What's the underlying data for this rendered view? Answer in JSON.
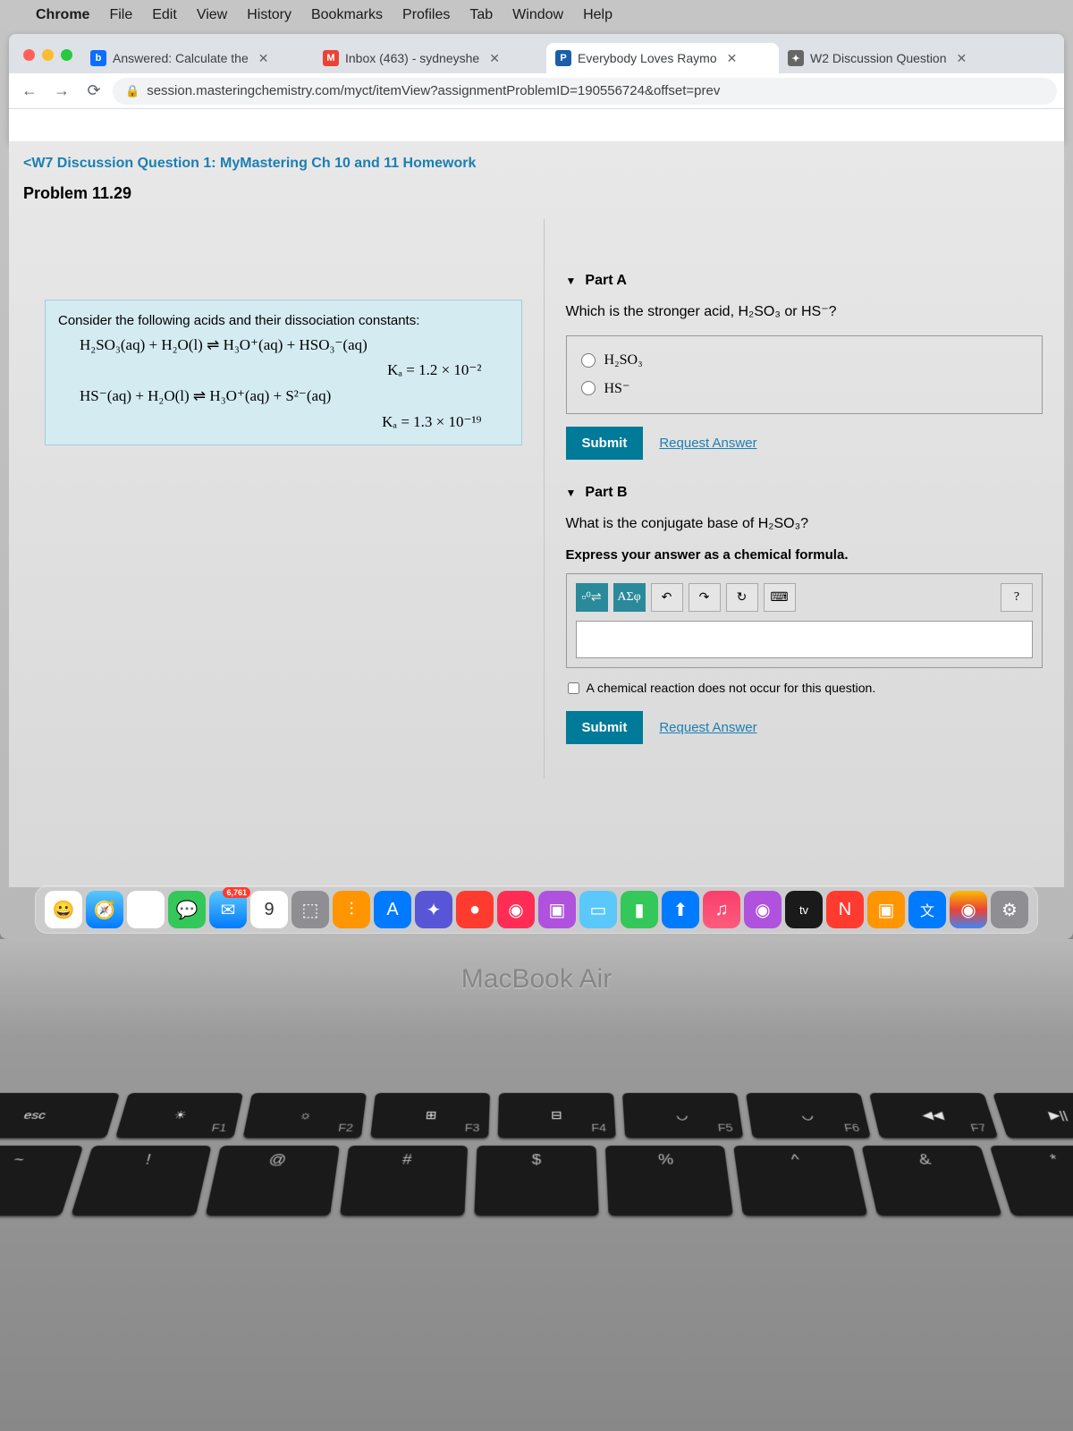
{
  "menubar": {
    "app": "Chrome",
    "items": [
      "File",
      "Edit",
      "View",
      "History",
      "Bookmarks",
      "Profiles",
      "Tab",
      "Window",
      "Help"
    ]
  },
  "tabs": [
    {
      "favicon": "b",
      "favcolor": "#0d6efd",
      "title": "Answered: Calculate the"
    },
    {
      "favicon": "M",
      "favcolor": "#ea4335",
      "title": "Inbox (463) - sydneyshe"
    },
    {
      "favicon": "P",
      "favcolor": "#1b5faa",
      "title": "Everybody Loves Raymo"
    },
    {
      "favicon": "✦",
      "favcolor": "#666",
      "title": "W2 Discussion Question"
    }
  ],
  "url": "session.masteringchemistry.com/myct/itemView?assignmentProblemID=190556724&offset=prev",
  "breadcrumb": "<W7 Discussion Question 1: MyMastering Ch 10 and 11 Homework",
  "problem_title": "Problem 11.29",
  "context": {
    "intro": "Consider the following acids and their dissociation constants:",
    "eq1": "H₂SO₃(aq) + H₂O(l) ⇌ H₃O⁺(aq) + HSO₃⁻(aq)",
    "ka1": "Kₐ = 1.2 × 10⁻²",
    "eq2": "HS⁻(aq) + H₂O(l) ⇌ H₃O⁺(aq) + S²⁻(aq)",
    "ka2": "Kₐ = 1.3 × 10⁻¹⁹"
  },
  "partA": {
    "title": "Part A",
    "question": "Which is the stronger acid, H₂SO₃ or HS⁻?",
    "opt1": "H₂SO₃",
    "opt2": "HS⁻",
    "submit": "Submit",
    "request": "Request Answer"
  },
  "partB": {
    "title": "Part B",
    "question": "What is the conjugate base of H₂SO₃?",
    "instruction": "Express your answer as a chemical formula.",
    "toolbar": {
      "templates": "▫⁰⇌",
      "greek": "ΑΣφ",
      "undo": "↶",
      "redo": "↷",
      "reset": "↻",
      "keyboard": "⌨",
      "help": "?"
    },
    "checkbox_label": "A chemical reaction does not occur for this question.",
    "submit": "Submit",
    "request": "Request Answer"
  },
  "dock_badge": "6,761",
  "laptop_label": "MacBook Air",
  "keys": {
    "esc": "esc",
    "fnrow": [
      {
        "icon": "☀",
        "label": "F1"
      },
      {
        "icon": "☼",
        "label": "F2"
      },
      {
        "icon": "⊞",
        "label": "F3"
      },
      {
        "icon": "⊟",
        "label": "F4"
      },
      {
        "icon": "◡",
        "label": "F5"
      },
      {
        "icon": "◡",
        "label": "F6"
      },
      {
        "icon": "◀◀",
        "label": "F7"
      },
      {
        "icon": "▶||",
        "label": ""
      }
    ],
    "symrow": [
      {
        "top": "~",
        "bot": ""
      },
      {
        "top": "!",
        "bot": ""
      },
      {
        "top": "@",
        "bot": ""
      },
      {
        "top": "#",
        "bot": ""
      },
      {
        "top": "$",
        "bot": ""
      },
      {
        "top": "%",
        "bot": ""
      },
      {
        "top": "^",
        "bot": ""
      },
      {
        "top": "&",
        "bot": ""
      },
      {
        "top": "*",
        "bot": ""
      }
    ]
  }
}
